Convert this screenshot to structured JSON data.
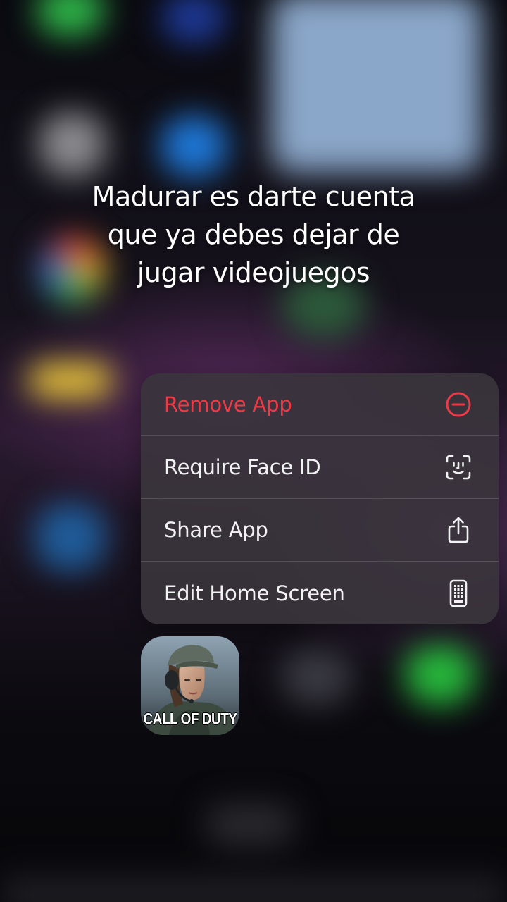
{
  "caption": {
    "line1": "Madurar es darte cuenta",
    "line2": "que ya debes dejar de",
    "line3": "jugar videojuegos"
  },
  "context_menu": {
    "items": [
      {
        "label": "Remove App",
        "icon": "minus-circle-icon",
        "destructive": true
      },
      {
        "label": "Require Face ID",
        "icon": "face-id-icon",
        "destructive": false
      },
      {
        "label": "Share App",
        "icon": "share-icon",
        "destructive": false
      },
      {
        "label": "Edit Home Screen",
        "icon": "phone-apps-icon",
        "destructive": false
      }
    ]
  },
  "app": {
    "name": "Call of Duty",
    "logo_text": "CALL OF DUTY"
  },
  "colors": {
    "destructive": "#ee3a47",
    "menu_text": "#f2f2f4",
    "menu_background": "#3a343c"
  }
}
